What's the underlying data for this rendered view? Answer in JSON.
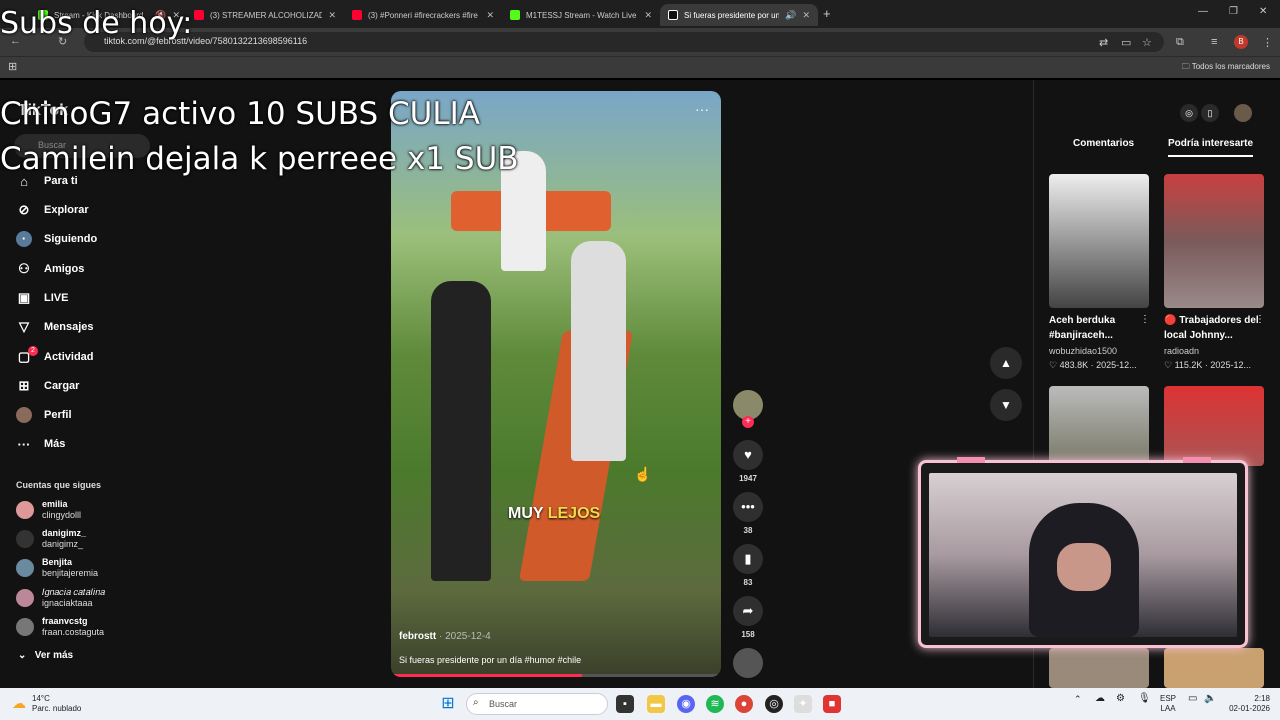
{
  "browser": {
    "tabs": [
      {
        "title": "Stream - Kick Dashboard",
        "color": "#53fc18"
      },
      {
        "title": "(3) STREAMER ALCOHOLIZADO",
        "color": "#ff0033"
      },
      {
        "title": "(3) #Ponneri #firecrackers #fire",
        "color": "#ff0033"
      },
      {
        "title": "M1TESSJ Stream - Watch Live o",
        "color": "#53fc18"
      },
      {
        "title": "Si fueras presidente por un",
        "color": "#111111"
      }
    ],
    "url": "tiktok.com/@febrostt/video/7580132213698596116",
    "bookmarks_label": "Todos los marcadores",
    "profile_initial": "B"
  },
  "overlay": {
    "line1": "Subs de hoy:",
    "line2": "ChinoG7 activo 10 SUBS CULIA",
    "line3": "Camilein dejala k perreee x1 SUB"
  },
  "tiktok": {
    "logo": "TikTok",
    "search_placeholder": "Buscar",
    "nav": [
      {
        "label": "Para ti",
        "icon": "home-icon"
      },
      {
        "label": "Explorar",
        "icon": "compass-icon"
      },
      {
        "label": "Siguiendo",
        "icon": "following-icon"
      },
      {
        "label": "Amigos",
        "icon": "friends-icon"
      },
      {
        "label": "LIVE",
        "icon": "live-icon"
      },
      {
        "label": "Mensajes",
        "icon": "messages-icon"
      },
      {
        "label": "Actividad",
        "icon": "activity-icon",
        "badge": "2"
      },
      {
        "label": "Cargar",
        "icon": "upload-icon"
      },
      {
        "label": "Perfil",
        "icon": "profile-icon"
      },
      {
        "label": "Más",
        "icon": "more-icon"
      }
    ],
    "following_header": "Cuentas que sigues",
    "following": [
      {
        "name": "emilia",
        "handle": "clingydolll"
      },
      {
        "name": "danigimz_",
        "handle": "danigimz_"
      },
      {
        "name": "Benjita",
        "handle": "benjitajeremia"
      },
      {
        "name": "𝐼𝑔𝑛𝑎𝑐𝑖𝑎 𝑐𝑎𝑡𝑎𝑙𝑖𝑛𝑎",
        "handle": "ignaciaktaaa"
      },
      {
        "name": "fraanvcstg",
        "handle": "fraan.costaguta"
      }
    ],
    "see_more": "Ver más",
    "video": {
      "caption_a": "MUY",
      "caption_b": "LEJOS",
      "author": "febrostt",
      "date": "· 2025-12-4",
      "description": "Si fueras presidente por un día #humor #chile",
      "progress": 0.58
    },
    "actions": {
      "likes": "1947",
      "comments": "38",
      "saves": "83",
      "shares": "158"
    },
    "right_panel": {
      "tab_comments": "Comentarios",
      "tab_interest": "Podría interesarte",
      "cards": [
        {
          "title": "Aceh berduka #banjiraceh...",
          "user": "wobuzhidao1500",
          "stats": "♡ 483.8K · 2025-12..."
        },
        {
          "title": "🔴 Trabajadores del local Johnny...",
          "user": "radioadn",
          "stats": "♡ 115.2K · 2025-12..."
        }
      ]
    }
  },
  "taskbar": {
    "weather_temp": "14°C",
    "weather_desc": "Parc. nublado",
    "search": "Buscar",
    "lang1": "ESP",
    "lang2": "LAA",
    "time": "2:18",
    "date": "02-01-2026"
  }
}
